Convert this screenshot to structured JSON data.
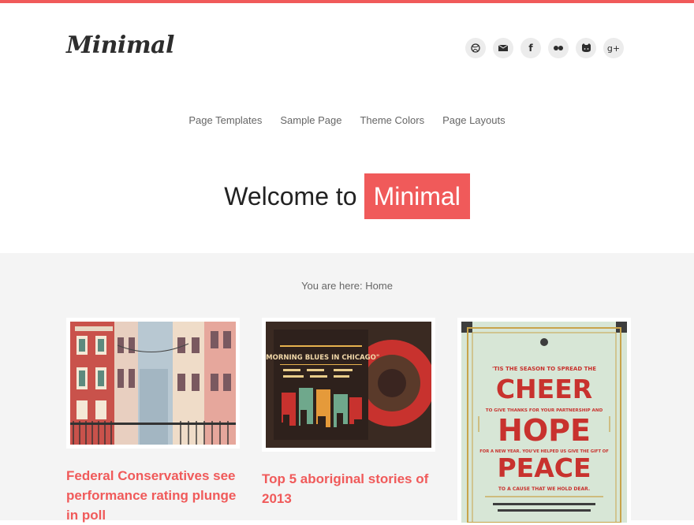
{
  "site": {
    "logo": "Minimal",
    "accent": "#f05a5a"
  },
  "social": [
    {
      "icon": "dribbble-icon",
      "glyph": ""
    },
    {
      "icon": "mail-icon",
      "glyph": ""
    },
    {
      "icon": "facebook-icon",
      "glyph": "f"
    },
    {
      "icon": "flickr-icon",
      "glyph": ""
    },
    {
      "icon": "github-icon",
      "glyph": ""
    },
    {
      "icon": "google-plus-icon",
      "glyph": "g+"
    }
  ],
  "nav": {
    "items": [
      "Page Templates",
      "Sample Page",
      "Theme Colors",
      "Page Layouts"
    ]
  },
  "hero": {
    "prefix": "Welcome to",
    "highlight": "Minimal"
  },
  "breadcrumb": "You are here: Home",
  "posts": [
    {
      "title": "Federal Conservatives see performance rating plunge in poll"
    },
    {
      "title": "Top 5 aboriginal stories of 2013"
    },
    {
      "title": ""
    }
  ],
  "poster": {
    "line1": "'TIS THE SEASON TO SPREAD THE",
    "cheer": "CHEER",
    "line2": "TO GIVE THANKS FOR YOUR PARTNERSHIP AND",
    "hope": "HOPE",
    "line3": "FOR A NEW YEAR. YOU'VE HELPED US GIVE THE GIFT OF",
    "peace": "PEACE",
    "line4": "TO A CAUSE THAT WE HOLD DEAR."
  },
  "album": {
    "title": "\"MORNING BLUES IN CHICAGO\""
  }
}
